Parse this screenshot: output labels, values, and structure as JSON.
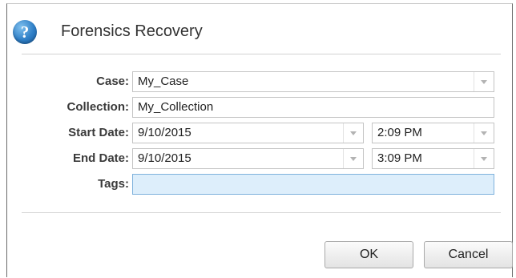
{
  "dialog": {
    "title": "Forensics Recovery",
    "icon": "help-question-icon"
  },
  "form": {
    "case": {
      "label": "Case:",
      "value": "My_Case"
    },
    "collection": {
      "label": "Collection:",
      "value": "My_Collection"
    },
    "start": {
      "label": "Start Date:",
      "date": "9/10/2015",
      "time": "2:09 PM"
    },
    "end": {
      "label": "End Date:",
      "date": "9/10/2015",
      "time": "3:09 PM"
    },
    "tags": {
      "label": "Tags:",
      "value": ""
    }
  },
  "buttons": {
    "ok": "OK",
    "cancel": "Cancel"
  },
  "colors": {
    "accent": "#2f7fc7",
    "focus_field": "#ddeefb"
  }
}
